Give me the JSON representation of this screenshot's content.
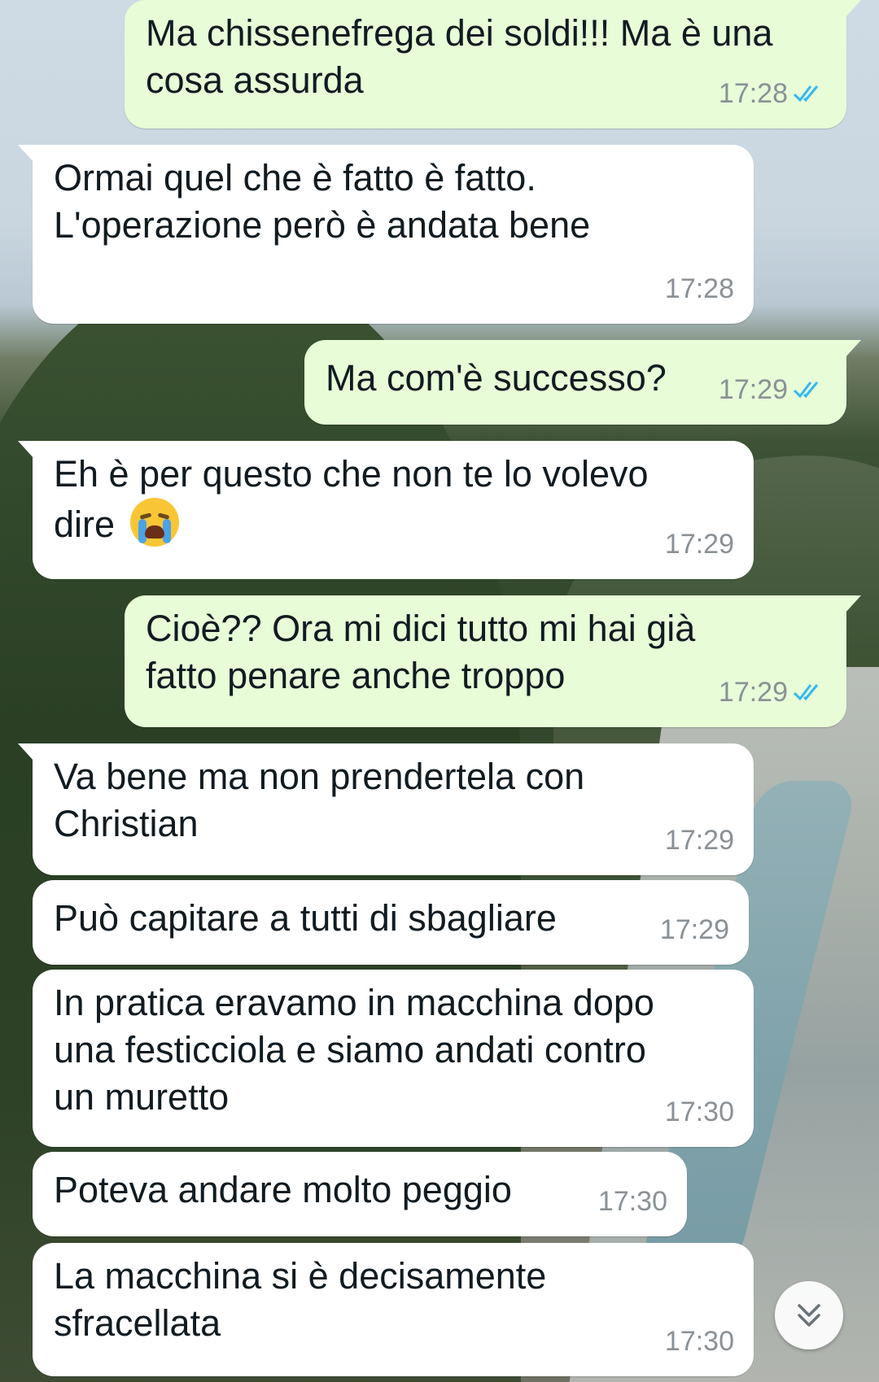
{
  "chat": {
    "messages": [
      {
        "direction": "out",
        "text": "Ma chissenefrega dei soldi!!! Ma è una\ncosa assurda",
        "time": "17:28",
        "status": "read"
      },
      {
        "direction": "in",
        "text": "Ormai quel che è fatto è fatto.\nL'operazione però è andata bene",
        "time": "17:28"
      },
      {
        "direction": "out",
        "text": "Ma com'è successo?",
        "time": "17:29",
        "status": "read"
      },
      {
        "direction": "in",
        "text": "Eh è per questo che non te lo volevo\ndire",
        "emoji": "loudly-crying-face-icon",
        "time": "17:29"
      },
      {
        "direction": "out",
        "text": "Cioè?? Ora mi dici tutto mi hai già\nfatto penare anche troppo",
        "time": "17:29",
        "status": "read"
      },
      {
        "direction": "in",
        "text": "Va bene ma non prendertela con\nChristian",
        "time": "17:29"
      },
      {
        "direction": "in",
        "text": "Può capitare a tutti di sbagliare",
        "time": "17:29"
      },
      {
        "direction": "in",
        "text": "In pratica eravamo in macchina dopo\nuna festicciola e siamo andati contro\nun muretto",
        "time": "17:30"
      },
      {
        "direction": "in",
        "text": "Poteva andare molto peggio",
        "time": "17:30"
      },
      {
        "direction": "in",
        "text": "La macchina si è decisamente\nsfracellata",
        "time": "17:30"
      }
    ]
  },
  "colors": {
    "incoming_bubble": "#ffffff",
    "outgoing_bubble": "#e7fcd7",
    "timestamp": "#8a9196",
    "read_ticks": "#34b7f1"
  },
  "scroll_button": {
    "icon": "double-chevron-down-icon"
  }
}
